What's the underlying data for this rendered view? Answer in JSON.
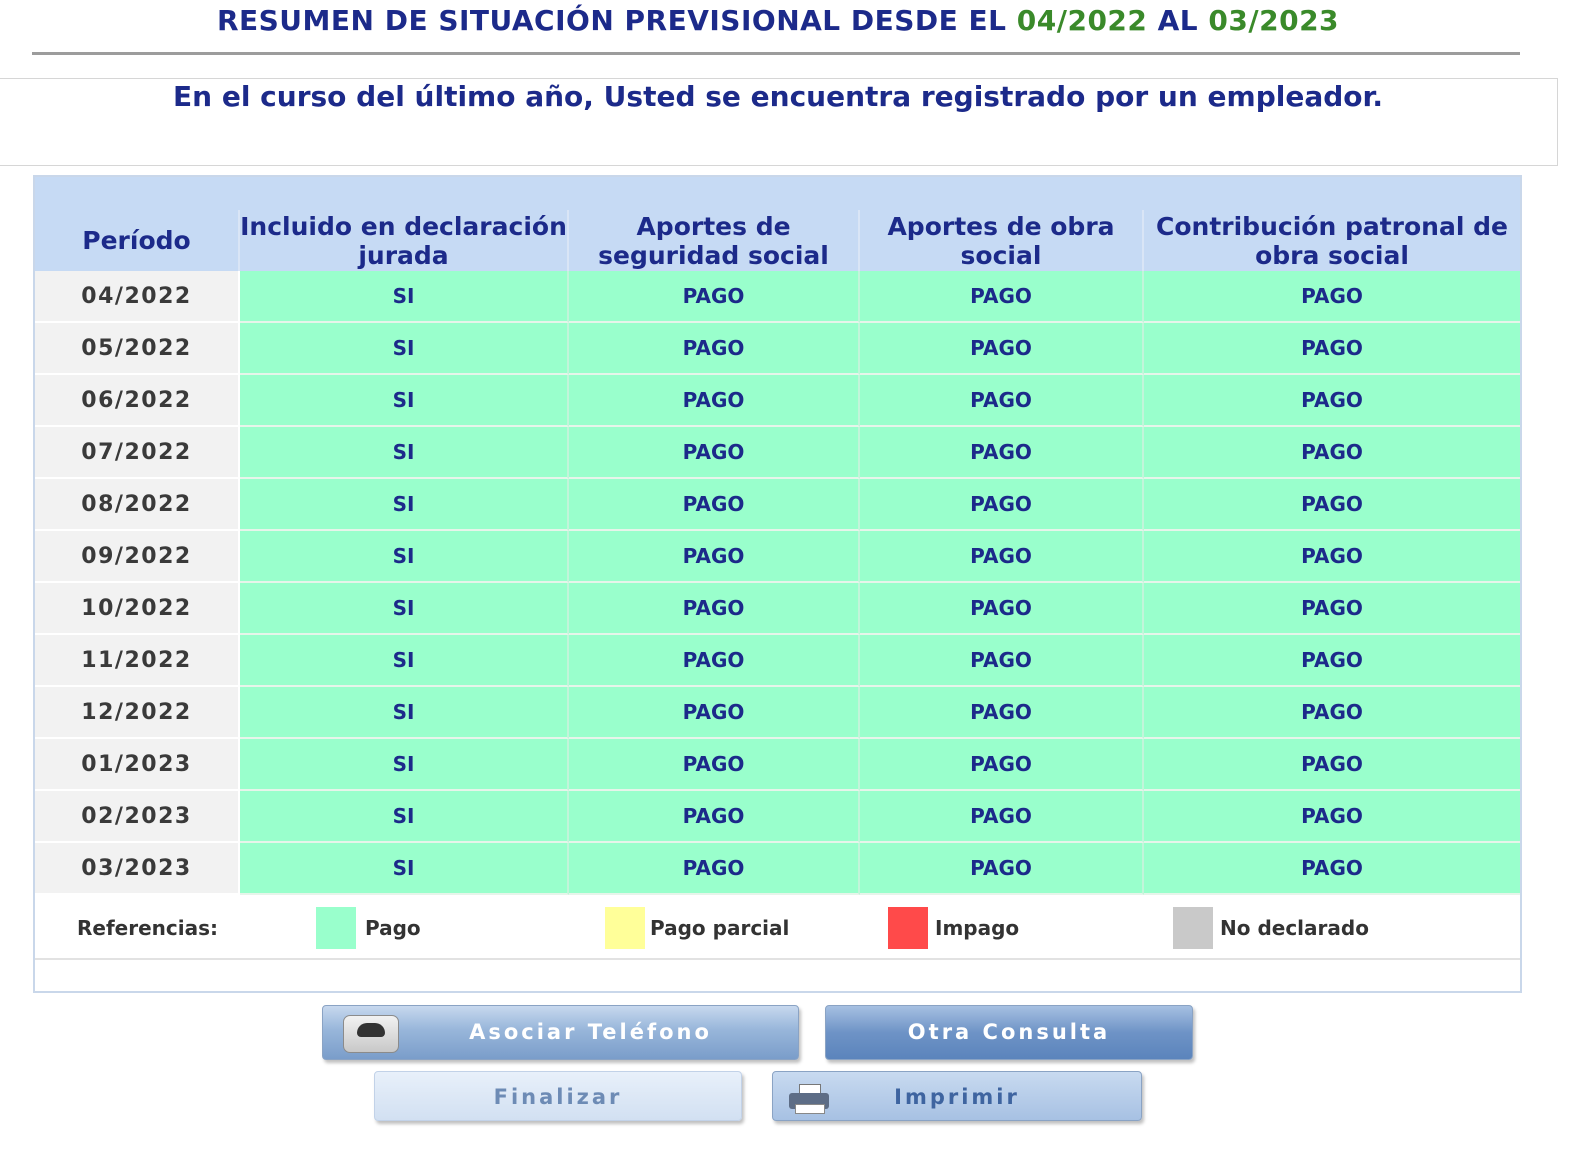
{
  "header": {
    "title_prefix": "RESUMEN DE SITUACIÓN PREVISIONAL DESDE EL ",
    "date_from": "04/2022",
    "title_middle": " AL ",
    "date_to": "03/2023"
  },
  "notice": "En el curso del último año, Usted se encuentra registrado por un empleador.",
  "table": {
    "columns": [
      "Período",
      "Incluido en declaración jurada",
      "Aportes de seguridad social",
      "Aportes de obra social",
      "Contribución patronal de obra social"
    ],
    "rows": [
      {
        "period": "04/2022",
        "declaracion": "SI",
        "seguridad": "PAGO",
        "obra": "PAGO",
        "contribucion": "PAGO"
      },
      {
        "period": "05/2022",
        "declaracion": "SI",
        "seguridad": "PAGO",
        "obra": "PAGO",
        "contribucion": "PAGO"
      },
      {
        "period": "06/2022",
        "declaracion": "SI",
        "seguridad": "PAGO",
        "obra": "PAGO",
        "contribucion": "PAGO"
      },
      {
        "period": "07/2022",
        "declaracion": "SI",
        "seguridad": "PAGO",
        "obra": "PAGO",
        "contribucion": "PAGO"
      },
      {
        "period": "08/2022",
        "declaracion": "SI",
        "seguridad": "PAGO",
        "obra": "PAGO",
        "contribucion": "PAGO"
      },
      {
        "period": "09/2022",
        "declaracion": "SI",
        "seguridad": "PAGO",
        "obra": "PAGO",
        "contribucion": "PAGO"
      },
      {
        "period": "10/2022",
        "declaracion": "SI",
        "seguridad": "PAGO",
        "obra": "PAGO",
        "contribucion": "PAGO"
      },
      {
        "period": "11/2022",
        "declaracion": "SI",
        "seguridad": "PAGO",
        "obra": "PAGO",
        "contribucion": "PAGO"
      },
      {
        "period": "12/2022",
        "declaracion": "SI",
        "seguridad": "PAGO",
        "obra": "PAGO",
        "contribucion": "PAGO"
      },
      {
        "period": "01/2023",
        "declaracion": "SI",
        "seguridad": "PAGO",
        "obra": "PAGO",
        "contribucion": "PAGO"
      },
      {
        "period": "02/2023",
        "declaracion": "SI",
        "seguridad": "PAGO",
        "obra": "PAGO",
        "contribucion": "PAGO"
      },
      {
        "period": "03/2023",
        "declaracion": "SI",
        "seguridad": "PAGO",
        "obra": "PAGO",
        "contribucion": "PAGO"
      }
    ]
  },
  "legend": {
    "label": "Referencias:",
    "items": [
      {
        "label": "Pago",
        "color": "#99ffcc"
      },
      {
        "label": "Pago parcial",
        "color": "#ffff99"
      },
      {
        "label": "Impago",
        "color": "#ff4a4a"
      },
      {
        "label": "No declarado",
        "color": "#c9c9c9"
      }
    ]
  },
  "buttons": {
    "asociar_telefono": "Asociar Teléfono",
    "otra_consulta": "Otra Consulta",
    "finalizar": "Finalizar",
    "imprimir": "Imprimir"
  },
  "colors": {
    "title_blue": "#1c2a8a",
    "date_green": "#3a8a2a",
    "header_band": "#c6daf4",
    "status_paid": "#99ffcc"
  },
  "icons": {
    "telefono": "phone-icon",
    "imprimir": "printer-icon"
  }
}
